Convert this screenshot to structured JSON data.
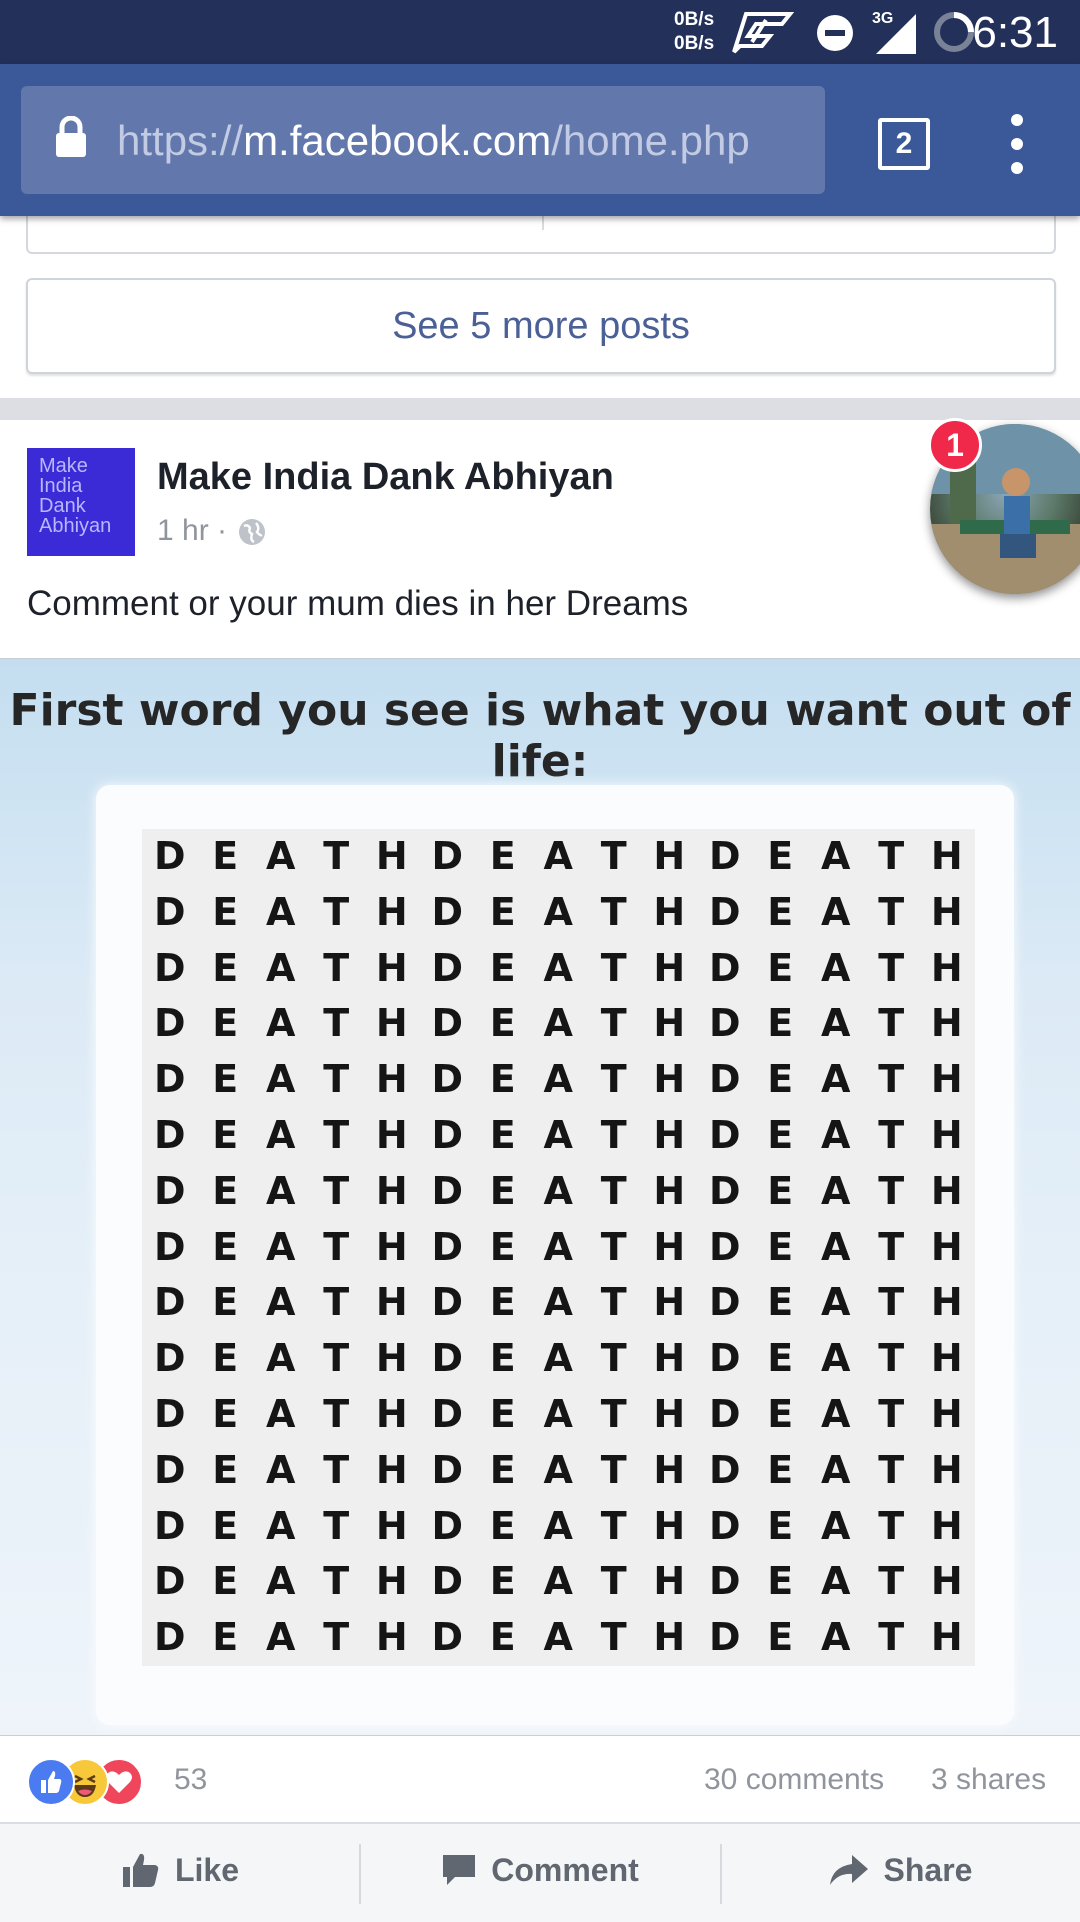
{
  "status_bar": {
    "net_up": "0B/s",
    "net_down": "0B/s",
    "network_type": "3G",
    "time": "6:31"
  },
  "browser": {
    "url_scheme": "https://",
    "url_host": "m.facebook.com",
    "url_path": "/home.php",
    "tab_count": "2"
  },
  "feed": {
    "see_more_label": "See 5 more posts"
  },
  "post": {
    "page_avatar_text": [
      "Make",
      "India",
      "Dank",
      "Abhiyan"
    ],
    "page_name": "Make India Dank Abhiyan",
    "time": "1 hr",
    "meta_separator": "·",
    "caption": "Comment or your mum dies in her Dreams",
    "image": {
      "title": "First word you see is what you want out of life:",
      "grid_rows": [
        "DEATHDEATHDEATH",
        "DEATHDEATHDEATH",
        "DEATHDEATHDEATH",
        "DEATHDEATHDEATH",
        "DEATHDEATHDEATH",
        "DEATHDEATHDEATH",
        "DEATHDEATHDEATH",
        "DEATHDEATHDEATH",
        "DEATHDEATHDEATH",
        "DEATHDEATHDEATH",
        "DEATHDEATHDEATH",
        "DEATHDEATHDEATH",
        "DEATHDEATHDEATH",
        "DEATHDEATHDEATH",
        "DEATHDEATHDEATH"
      ]
    },
    "reaction_count": "53",
    "reactions": [
      "like-icon",
      "haha-icon",
      "love-icon"
    ],
    "comments": "30 comments",
    "shares": "3 shares"
  },
  "chat_head": {
    "badge": "1"
  },
  "actions": {
    "like": "Like",
    "comment": "Comment",
    "share": "Share"
  },
  "colors": {
    "facebook_blue": "#3b5998",
    "status_bar": "#23305a",
    "badge_red": "#f02849"
  }
}
